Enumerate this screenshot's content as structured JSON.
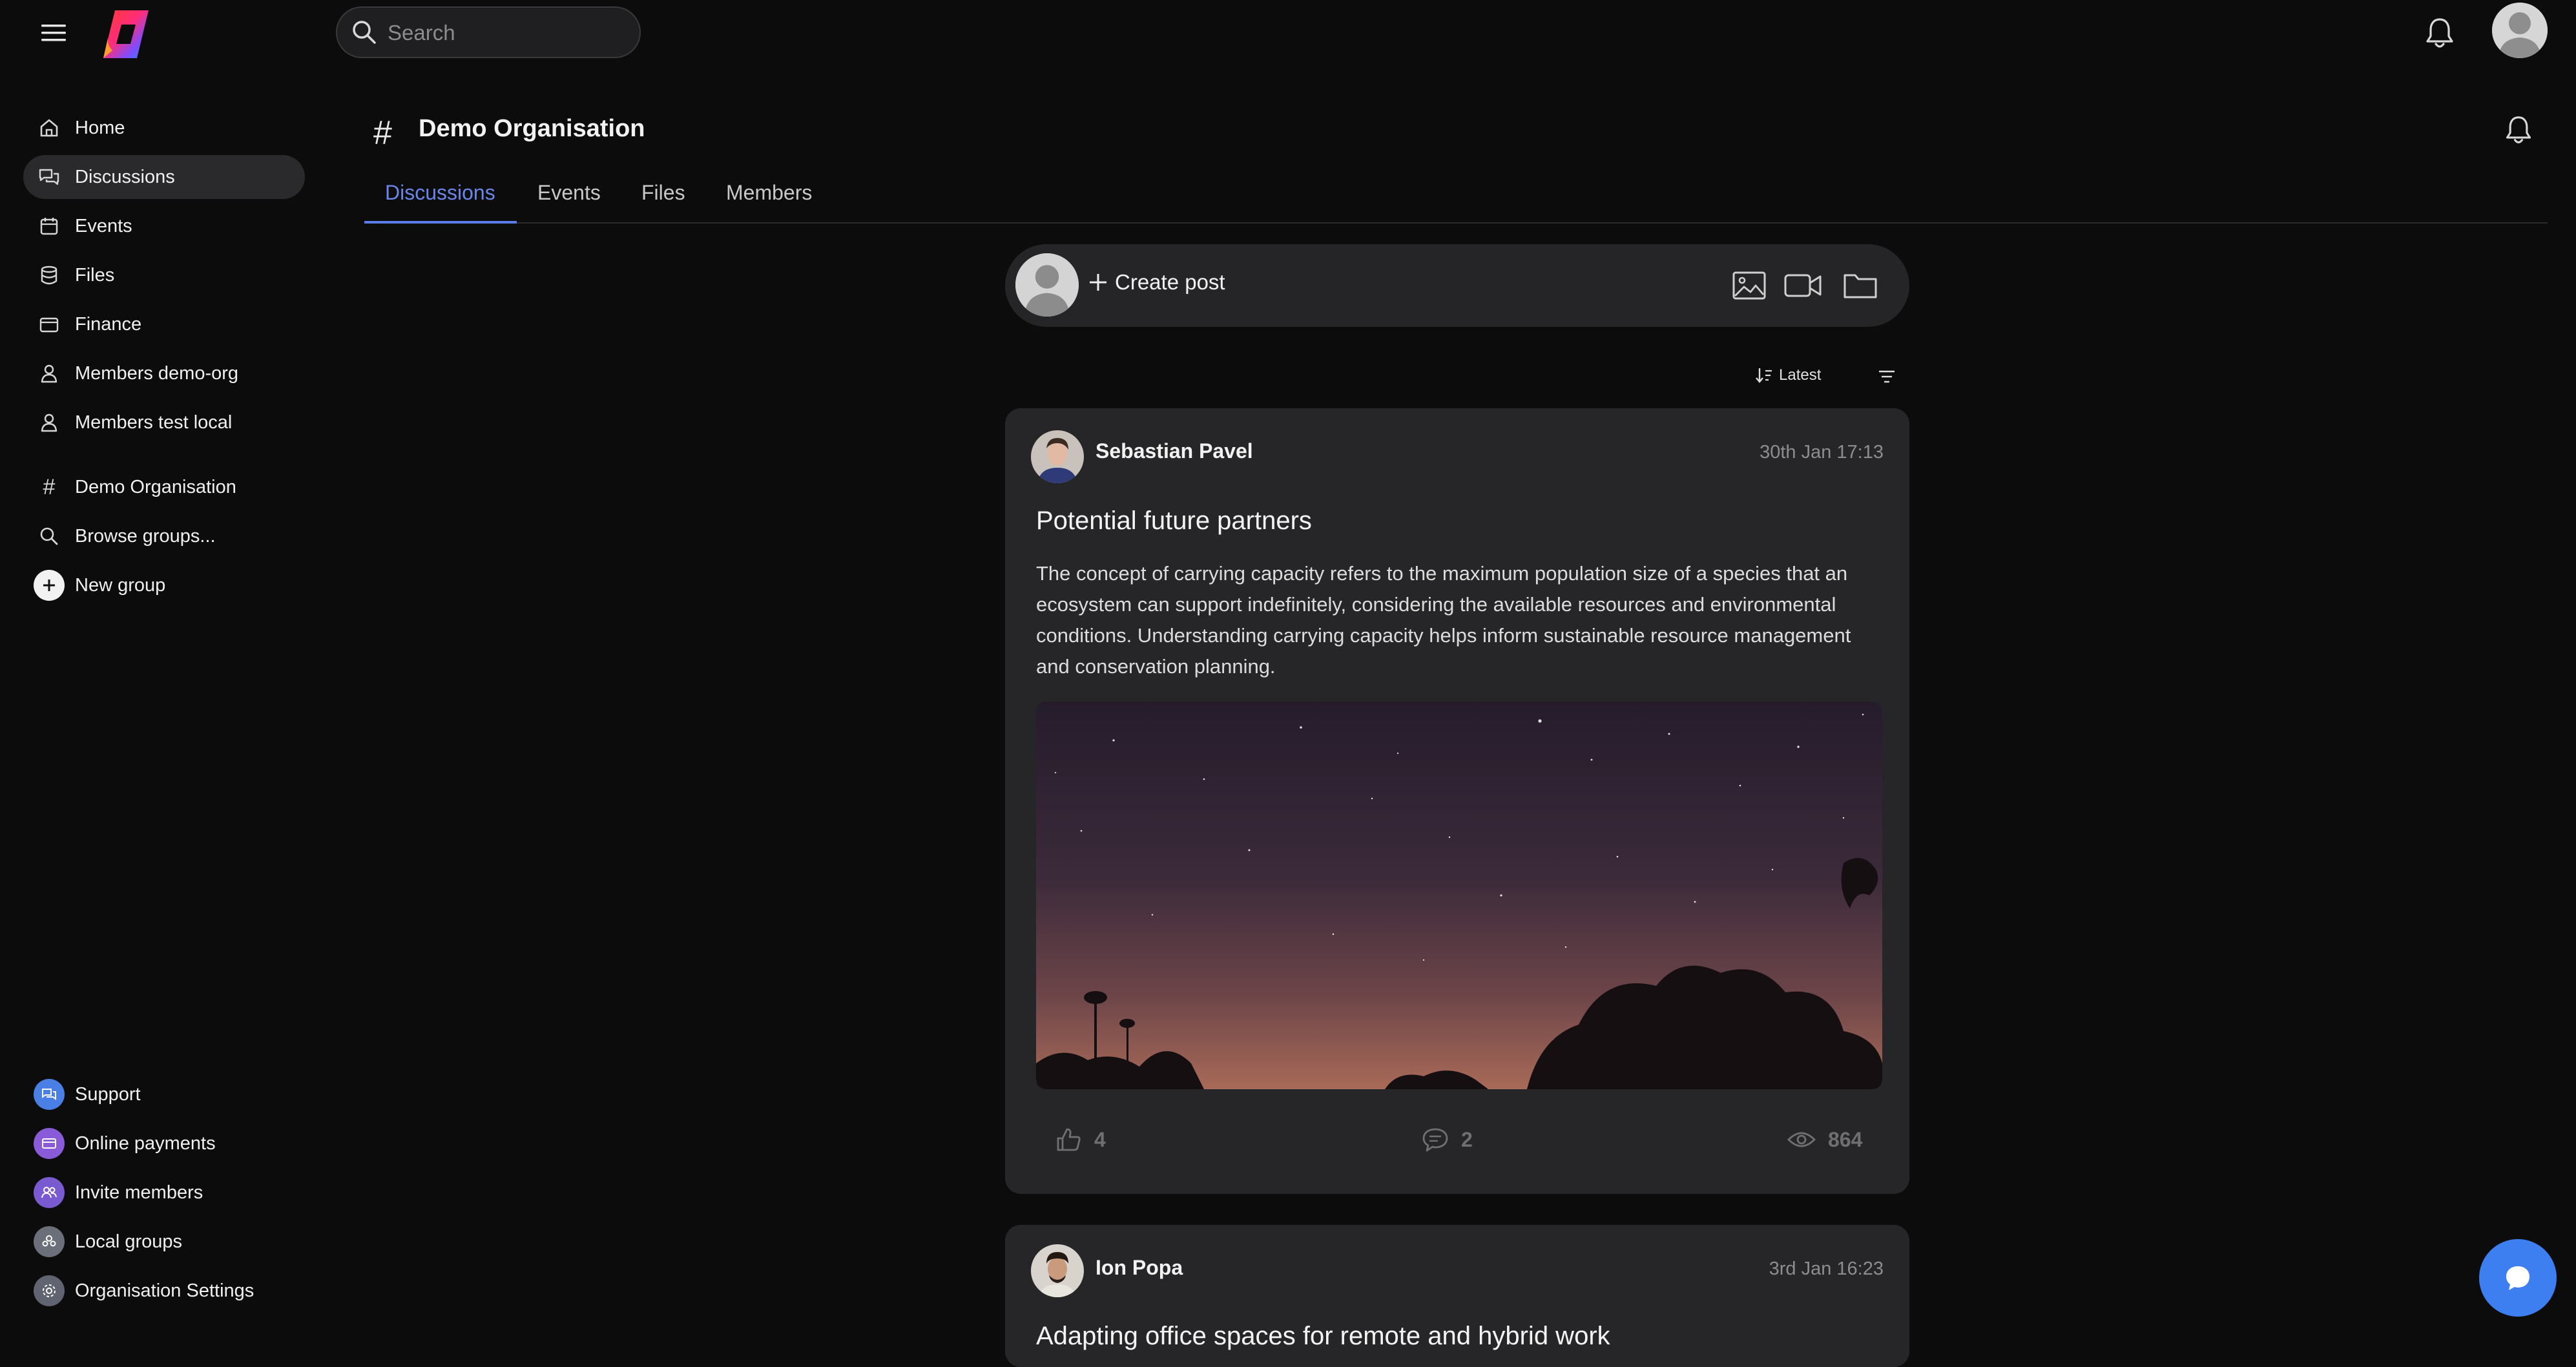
{
  "app": {
    "search_placeholder": "Search"
  },
  "colors": {
    "accent": "#5a7de8",
    "background": "#0c0c0d",
    "card": "#262628",
    "fab": "#3d7ff0"
  },
  "sidebar": {
    "nav": [
      {
        "label": "Home",
        "icon": "home-icon"
      },
      {
        "label": "Discussions",
        "icon": "chat-icon",
        "active": true
      },
      {
        "label": "Events",
        "icon": "calendar-icon"
      },
      {
        "label": "Files",
        "icon": "database-icon"
      },
      {
        "label": "Finance",
        "icon": "wallet-icon"
      },
      {
        "label": "Members demo-org",
        "icon": "person-icon"
      },
      {
        "label": "Members test local",
        "icon": "person-icon"
      }
    ],
    "groups": [
      {
        "label": "Demo Organisation",
        "icon": "hash-icon"
      },
      {
        "label": "Browse groups...",
        "icon": "search-icon"
      },
      {
        "label": "New group",
        "icon": "plus-circle-icon"
      }
    ],
    "bottom": [
      {
        "label": "Support",
        "icon": "support-icon"
      },
      {
        "label": "Online payments",
        "icon": "payments-icon"
      },
      {
        "label": "Invite members",
        "icon": "invite-icon"
      },
      {
        "label": "Local groups",
        "icon": "local-groups-icon"
      },
      {
        "label": "Organisation Settings",
        "icon": "settings-gear-icon"
      }
    ]
  },
  "header": {
    "title": "Demo Organisation",
    "tabs": [
      {
        "label": "Discussions",
        "active": true
      },
      {
        "label": "Events"
      },
      {
        "label": "Files"
      },
      {
        "label": "Members"
      }
    ]
  },
  "composer": {
    "label": "Create post"
  },
  "feed": {
    "sort_label": "Latest",
    "posts": [
      {
        "author": "Sebastian Pavel",
        "date": "30th Jan 17:13",
        "title": "Potential future partners",
        "body": "The concept of carrying capacity refers to the maximum population size of a species that an ecosystem can support indefinitely, considering the available resources and environmental conditions. Understanding carrying capacity helps inform sustainable resource management and conservation planning.",
        "likes": "4",
        "comments": "2",
        "views": "864"
      },
      {
        "author": "Ion Popa",
        "date": "3rd Jan 16:23",
        "title": "Adapting office spaces for remote and hybrid work"
      }
    ]
  }
}
